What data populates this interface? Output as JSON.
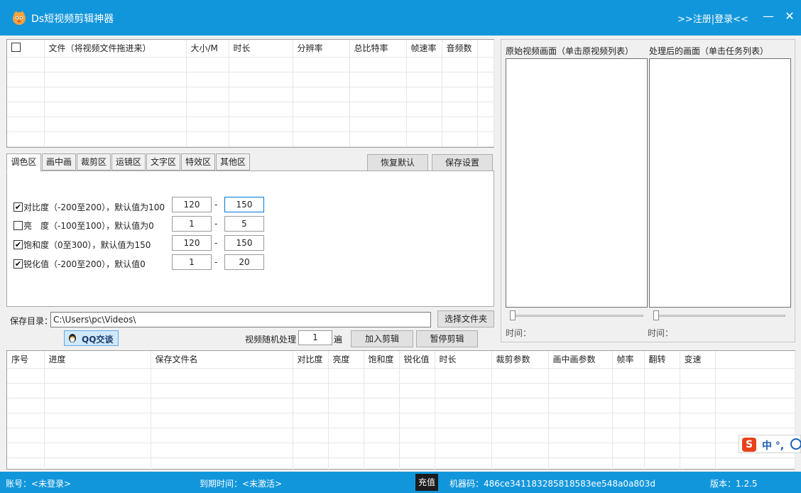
{
  "titlebar": {
    "title": "Ds短视频剪辑神器",
    "login": ">>注册|登录<<",
    "minimize": "—",
    "close": "✕"
  },
  "file_table": {
    "columns": [
      "",
      "文件（将视频文件拖进来）",
      "大小/M",
      "时长",
      "分辨率",
      "总比特率",
      "帧速率",
      "音频数"
    ]
  },
  "tabs": [
    "调色区",
    "画中画",
    "裁剪区",
    "运镜区",
    "文字区",
    "特效区",
    "其他区"
  ],
  "buttons": {
    "restore_default": "恢复默认",
    "save_settings": "保存设置",
    "choose_folder": "选择文件夹",
    "add_edit": "加入剪辑",
    "pause_edit": "暂停剪辑",
    "qq_chat": "QQ交谈",
    "recharge": "充值"
  },
  "settings": [
    {
      "label": "对比度（-200至200），默认值为100",
      "checked": true,
      "min": "120",
      "max": "150"
    },
    {
      "label": "亮　度（-100至100），默认值为0",
      "checked": false,
      "min": "1",
      "max": "5"
    },
    {
      "label": "饱和度（0至300），默认值为150",
      "checked": true,
      "min": "120",
      "max": "150"
    },
    {
      "label": "锐化值（-200至200），默认值0",
      "checked": true,
      "min": "1",
      "max": "20"
    }
  ],
  "dash": "-",
  "save_dir": {
    "label": "保存目录：",
    "value": "C:\\Users\\pc\\Videos\\"
  },
  "random": {
    "label": "视频随机处理",
    "value": "1",
    "unit": "遍"
  },
  "preview": {
    "original_label": "原始视频画面（单击原视频列表）",
    "processed_label": "处理后的画面（单击任务列表）",
    "time_label": "时间："
  },
  "task_table": {
    "columns": [
      "序号",
      "进度",
      "保存文件名",
      "对比度",
      "亮度",
      "饱和度",
      "锐化值",
      "时长",
      "裁剪参数",
      "画中画参数",
      "帧率",
      "翻转",
      "变速"
    ]
  },
  "status": {
    "account": "账号：<未登录>",
    "expire": "到期时间：<未激活>",
    "machine_code": "机器码：486ce341183285818583ee548a0a803d",
    "version": "版本：1.2.5"
  },
  "ime": {
    "text": "中 °,"
  },
  "colors": {
    "brand": "#1296db",
    "accent_focus": "#0078d7"
  }
}
